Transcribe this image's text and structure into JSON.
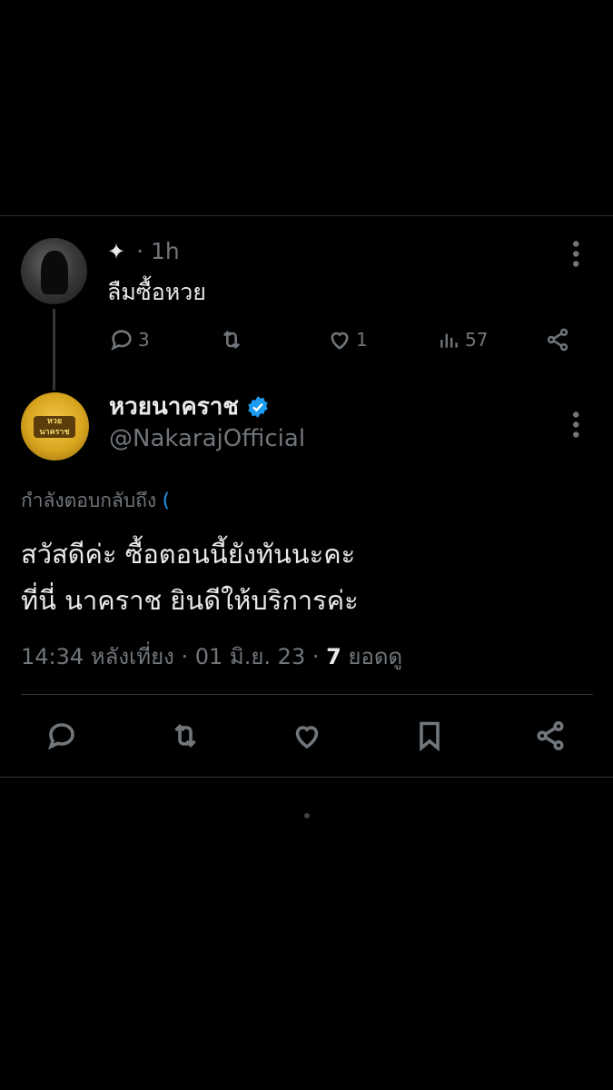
{
  "reply_tweet": {
    "author_name": "",
    "time": "· 1h",
    "text": "ลืมซื้อหวย",
    "stats": {
      "replies": "3",
      "likes": "1",
      "views": "57"
    }
  },
  "main_tweet": {
    "author_name": "หวยนาคราช",
    "handle": "@NakarajOfficial",
    "replying_to_label": "กำลังตอบกลับถึง",
    "replying_to_user": "(",
    "body_lines": [
      "สวัสดีค่ะ ซื้อตอนนี้ยังทันนะคะ",
      "ที่นี่ นาคราช ยินดีให้บริการค่ะ"
    ],
    "time": "14:34 หลังเที่ยง · 01 มิ.ย. 23 · ",
    "views_count": "7",
    "views_label": " ยอดดู",
    "avatar_text": "หวย นาคราช"
  },
  "colors": {
    "background": "#000000",
    "text": "#e7e9ea",
    "muted": "#71767b",
    "verified": "#1d9bf0",
    "border": "#2f3336"
  },
  "icons": [
    "sparkle-icon",
    "reply-icon",
    "retweet-icon",
    "like-icon",
    "views-icon",
    "share-icon",
    "bookmark-icon",
    "more-icon",
    "verified-icon"
  ]
}
